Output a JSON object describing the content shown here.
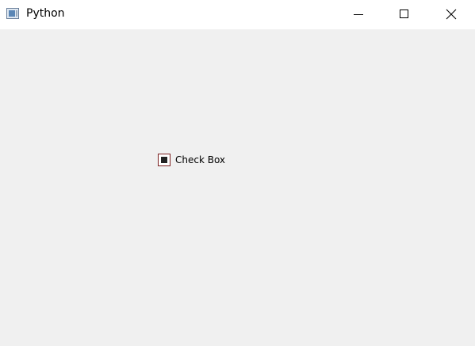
{
  "window": {
    "title": "Python",
    "icon": "python-app-icon",
    "controls": {
      "minimize": "minimize-icon",
      "maximize": "maximize-icon",
      "close": "close-icon"
    }
  },
  "content": {
    "checkbox": {
      "label": "Check Box",
      "state": "partially-checked",
      "border_color": "#7a1f1f",
      "fill_color": "#222222"
    }
  },
  "colors": {
    "titlebar": "#ffffff",
    "background": "#f0f0f0"
  }
}
